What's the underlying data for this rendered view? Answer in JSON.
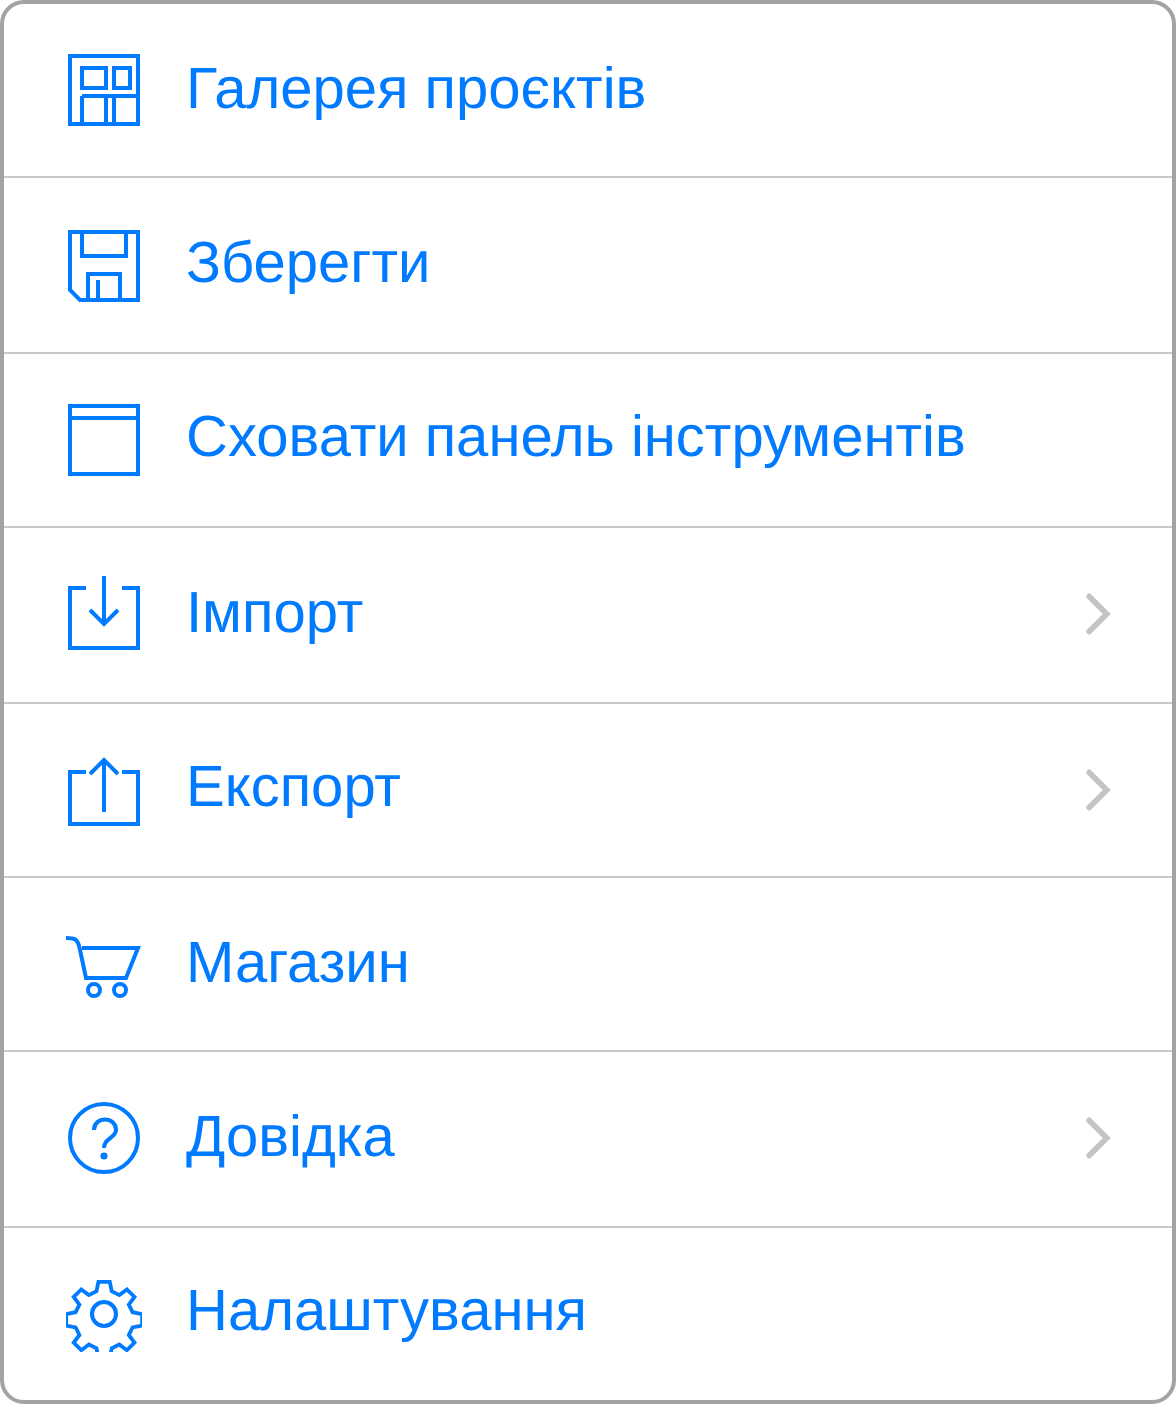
{
  "menu": {
    "items": [
      {
        "label": "Галерея проєктів",
        "submenu": false
      },
      {
        "label": "Зберегти",
        "submenu": false
      },
      {
        "label": "Сховати панель інструментів",
        "submenu": false
      },
      {
        "label": "Імпорт",
        "submenu": true
      },
      {
        "label": "Експорт",
        "submenu": true
      },
      {
        "label": "Магазин",
        "submenu": false
      },
      {
        "label": "Довідка",
        "submenu": true
      },
      {
        "label": "Налаштування",
        "submenu": false
      }
    ]
  }
}
